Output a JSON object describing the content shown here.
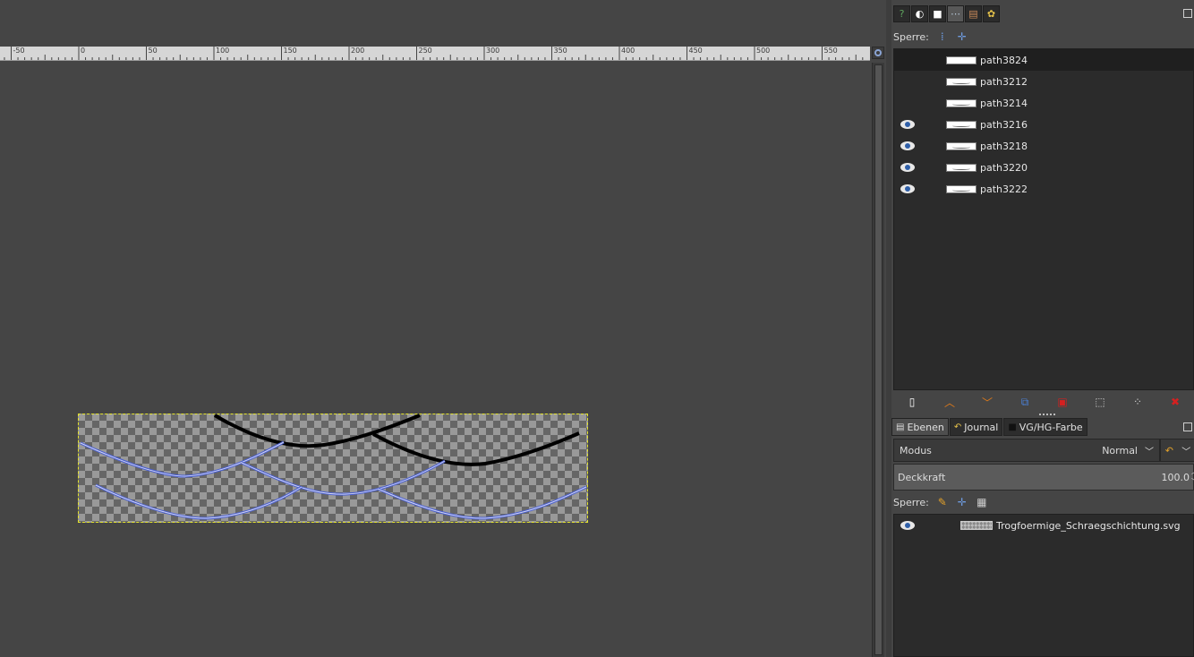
{
  "ruler": {
    "labels": [
      "-50",
      "0",
      "50",
      "100",
      "150",
      "200",
      "250",
      "300",
      "350",
      "400",
      "450",
      "500",
      "550"
    ]
  },
  "dock_top": {
    "tabs": [
      {
        "icon": "tool-options-icon",
        "glyph": "?"
      },
      {
        "icon": "device-status-icon",
        "glyph": "◐"
      },
      {
        "icon": "undo-history-icon",
        "glyph": "■"
      },
      {
        "icon": "paths-icon",
        "glyph": "⋯"
      },
      {
        "icon": "channels-icon",
        "glyph": "▤"
      },
      {
        "icon": "palette-icon",
        "glyph": "✿"
      }
    ]
  },
  "paths_panel": {
    "lock_label": "Sperre:",
    "paths": [
      {
        "name": "path3824",
        "visible": false,
        "selected": true
      },
      {
        "name": "path3212",
        "visible": false,
        "selected": false
      },
      {
        "name": "path3214",
        "visible": false,
        "selected": false
      },
      {
        "name": "path3216",
        "visible": true,
        "selected": false
      },
      {
        "name": "path3218",
        "visible": true,
        "selected": false
      },
      {
        "name": "path3220",
        "visible": true,
        "selected": false
      },
      {
        "name": "path3222",
        "visible": true,
        "selected": false
      }
    ]
  },
  "layers_panel": {
    "tabs": [
      {
        "label": "Ebenen",
        "icon": "layers-icon"
      },
      {
        "label": "Journal",
        "icon": "undo-icon"
      },
      {
        "label": "VG/HG-Farbe",
        "icon": "fg-bg-color-icon"
      }
    ],
    "mode_label": "Modus",
    "mode_value": "Normal",
    "opacity_label": "Deckkraft",
    "opacity_value": "100.0",
    "lock_label": "Sperre:",
    "layers": [
      {
        "name": "Trogfoermige_Schraegschichtung.svg",
        "visible": true
      }
    ]
  },
  "colors": {
    "accent_blue": "#4a5fcf",
    "selection_yellow": "#e5e52a",
    "delete_red": "#d42020",
    "arrow_orange": "#e07b1a"
  }
}
